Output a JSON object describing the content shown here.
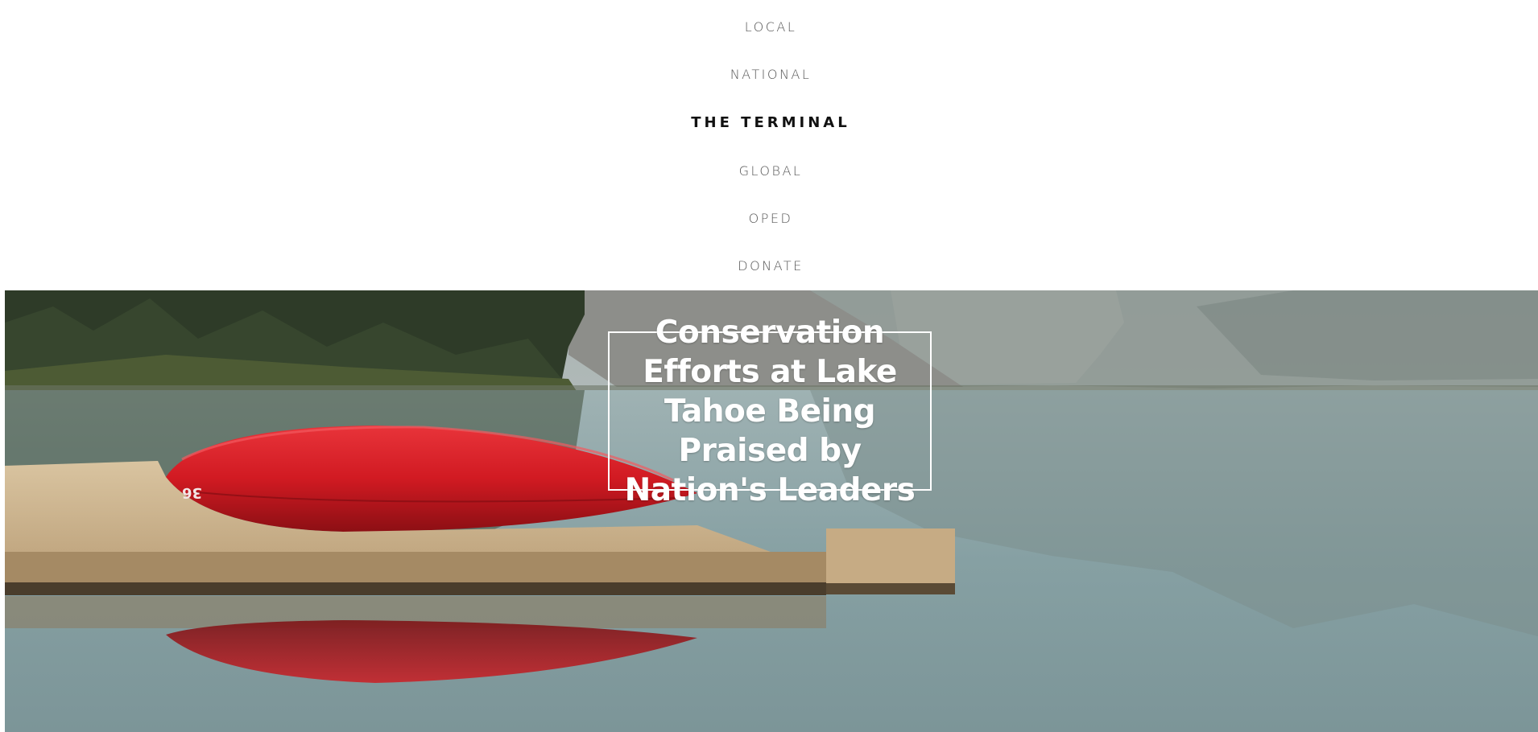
{
  "nav": {
    "items": [
      {
        "label": "LOCAL",
        "active": false
      },
      {
        "label": "NATIONAL",
        "active": false
      },
      {
        "label": "THE TERMINAL",
        "active": true
      },
      {
        "label": "GLOBAL",
        "active": false
      },
      {
        "label": "OPED",
        "active": false
      },
      {
        "label": "DONATE",
        "active": false
      }
    ]
  },
  "hero": {
    "headline": "Conservation Efforts at Lake Tahoe Being Praised by Nation's Leaders",
    "canoe_number": "36"
  },
  "colors": {
    "canoe_red": "#d11a22",
    "lake": "#8fa5a8",
    "forest": "#2c3a26",
    "dock": "#cbb08a"
  }
}
